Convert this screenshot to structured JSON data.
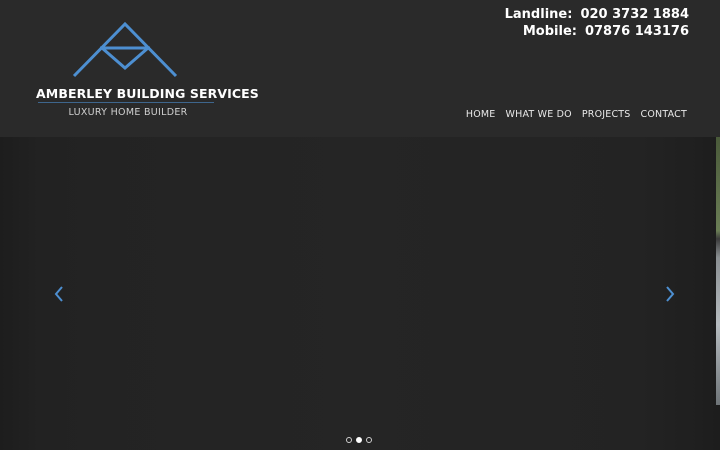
{
  "brand": {
    "name": "AMBERLEY BUILDING SERVICES",
    "tagline": "LUXURY HOME BUILDER",
    "accent_color": "#4d8fd1"
  },
  "contact": {
    "landline_label": "Landline:",
    "landline_number": "020 3732 1884",
    "mobile_label": "Mobile:",
    "mobile_number": "07876 143176"
  },
  "nav": {
    "items": [
      {
        "label": "HOME"
      },
      {
        "label": "WHAT WE DO"
      },
      {
        "label": "PROJECTS"
      },
      {
        "label": "CONTACT"
      }
    ]
  },
  "slider": {
    "prev_icon": "chevron-left-icon",
    "next_icon": "chevron-right-icon",
    "slide_count": 3,
    "active_slide": 2
  }
}
